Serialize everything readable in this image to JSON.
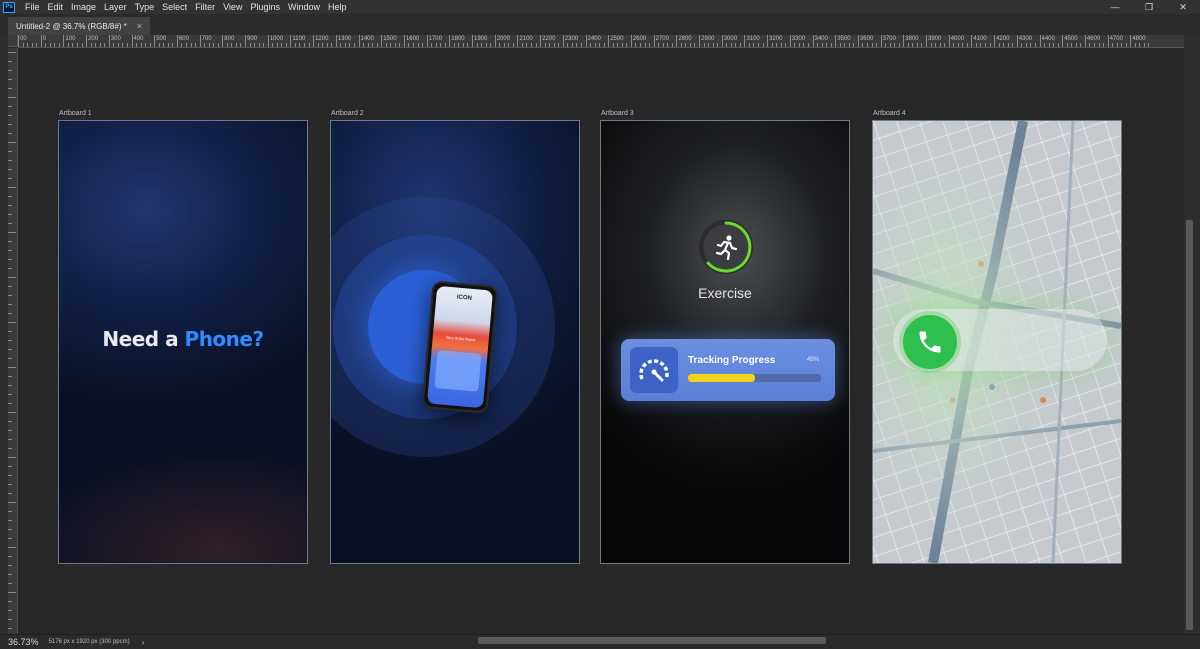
{
  "app": {
    "logo": "Ps"
  },
  "menu": [
    "File",
    "Edit",
    "Image",
    "Layer",
    "Type",
    "Select",
    "Filter",
    "View",
    "Plugins",
    "Window",
    "Help"
  ],
  "window_controls": {
    "minimize": "—",
    "restore": "❐",
    "close": "✕"
  },
  "document_tab": {
    "title": "Untitled-2 @ 36.7% (RGB/8#) *",
    "close": "×"
  },
  "ruler_labels": [
    "00",
    "0",
    "100",
    "200",
    "300",
    "400",
    "500",
    "600",
    "700",
    "800",
    "900",
    "1000",
    "1100",
    "1200",
    "1300",
    "1400",
    "1500",
    "1600",
    "1700",
    "1800",
    "1900",
    "2000",
    "2100",
    "2200",
    "2300",
    "2400",
    "2500",
    "2600",
    "2700",
    "2800",
    "2900",
    "3000",
    "3100",
    "3200",
    "3300",
    "3400",
    "3500",
    "3600",
    "3700",
    "3800",
    "3900",
    "4000",
    "4100",
    "4200",
    "4300",
    "4400",
    "4500",
    "4600",
    "4700",
    "4800"
  ],
  "artboards": {
    "ab1": {
      "label": "Artboard 1",
      "headline_prefix": "Need a ",
      "headline_accent": "Phone?"
    },
    "ab2": {
      "label": "Artboard 2",
      "phone_text": "ICON",
      "phone_subtitle": "Your Artist Name"
    },
    "ab3": {
      "label": "Artboard 3",
      "exercise_label": "Exercise",
      "tracking_title": "Tracking Progress",
      "tracking_percent_text": "45%",
      "tracking_progress": 0.5,
      "accent_color": "#f2d21a",
      "ring_color": "#6cd82e"
    },
    "ab4": {
      "label": "Artboard 4",
      "call_color": "#2fbf4f"
    }
  },
  "status": {
    "zoom": "36.73%",
    "doc_info": "5176 px x 1920 px (300 ppcm)",
    "arrow": "›"
  }
}
